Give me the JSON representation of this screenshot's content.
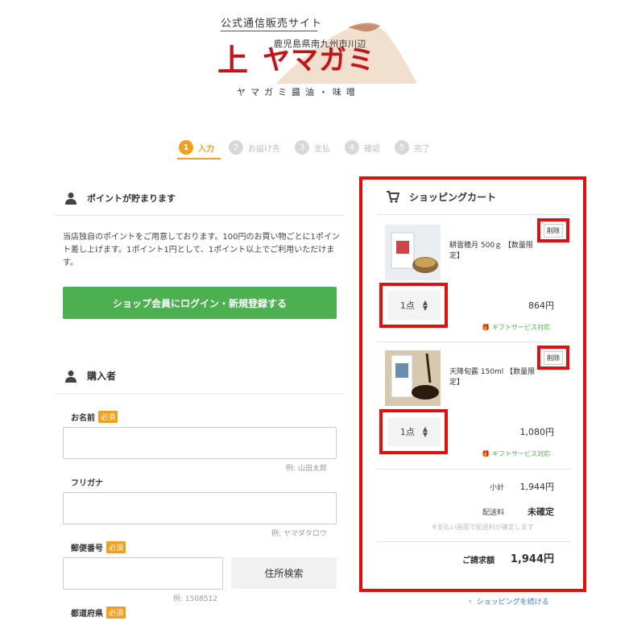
{
  "logo": {
    "tagline": "公式通信販売サイト",
    "region": "鹿児島県南九州市川辺",
    "mark": "上",
    "brand": "ヤマガミ",
    "sub": "ヤマガミ醤油・味噌"
  },
  "steps": [
    {
      "num": "1",
      "label": "入力",
      "active": true
    },
    {
      "num": "2",
      "label": "お届け先"
    },
    {
      "num": "3",
      "label": "支払"
    },
    {
      "num": "4",
      "label": "確認"
    },
    {
      "num": "5",
      "label": "完了"
    }
  ],
  "points": {
    "heading": "ポイントが貯まります",
    "text": "当店独自のポイントをご用意しております。100円のお買い物ごとに1ポイント差し上げます。1ポイント1円として、1ポイント以上でご利用いただけます。",
    "login_button": "ショップ会員にログイン・新規登録する"
  },
  "buyer": {
    "heading": "購入者",
    "required_badge": "必須",
    "name_label": "お名前",
    "name_example": "例: 山田太郎",
    "kana_label": "フリガナ",
    "kana_example": "例: ヤマダタロウ",
    "zip_label": "郵便番号",
    "zip_example": "例: 1508512",
    "address_search": "住所検索",
    "pref_label": "都道府県"
  },
  "cart": {
    "title": "ショッピングカート",
    "delete_label": "削除",
    "gift_label": "ギフトサービス対応",
    "items": [
      {
        "name": "耕雲穂月 500ｇ 【数量限定】",
        "qty": "1点",
        "price": "864円"
      },
      {
        "name": "天降旬露 150ml 【数量限定】",
        "qty": "1点",
        "price": "1,080円"
      }
    ],
    "subtotal_label": "小計",
    "subtotal": "1,944円",
    "shipping_label": "配送料",
    "shipping": "未確定",
    "shipping_note": "※支払い画面で配送料が確定します",
    "total_label": "ご請求額",
    "total": "1,944円",
    "continue_label": "ショッピングを続ける"
  },
  "colors": {
    "accent": "#f0a020",
    "brand": "#c0151b",
    "green": "#4caf50",
    "highlight": "#e01010"
  }
}
